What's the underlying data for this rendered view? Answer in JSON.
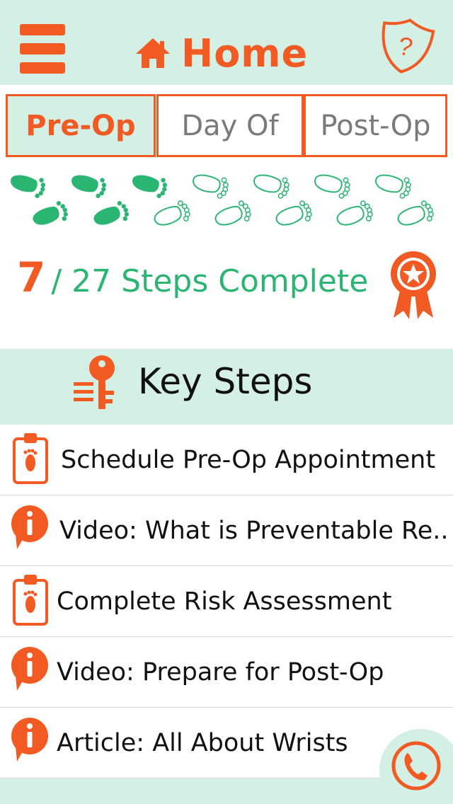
{
  "header": {
    "title": "Home",
    "menu_icon": "hamburger-menu-icon",
    "home_icon": "house-icon",
    "help_icon": "shield-question-icon"
  },
  "tabs": [
    {
      "label": "Pre-Op",
      "active": true
    },
    {
      "label": "Day Of",
      "active": false
    },
    {
      "label": "Post-Op",
      "active": false
    }
  ],
  "progress": {
    "completed": "7",
    "total_text": "/ 27 Steps Complete",
    "completed_count": 7,
    "total_count": 27,
    "award_icon": "award-ribbon-icon"
  },
  "key_steps": {
    "title": "Key Steps",
    "icon": "key-icon",
    "items": [
      {
        "label": "Schedule Pre-Op Appointment",
        "icon": "clipboard-foot-icon"
      },
      {
        "label": "Video: What is Preventable Re...",
        "icon": "info-bubble-icon"
      },
      {
        "label": "Complete Risk Assessment",
        "icon": "clipboard-foot-icon"
      },
      {
        "label": "Video: Prepare for Post-Op",
        "icon": "info-bubble-icon"
      },
      {
        "label": "Article: All About Wrists",
        "icon": "info-bubble-icon"
      }
    ]
  },
  "call_icon": "phone-icon",
  "colors": {
    "accent": "#f15a22",
    "green": "#2bb573",
    "mint": "#d4efe3"
  }
}
